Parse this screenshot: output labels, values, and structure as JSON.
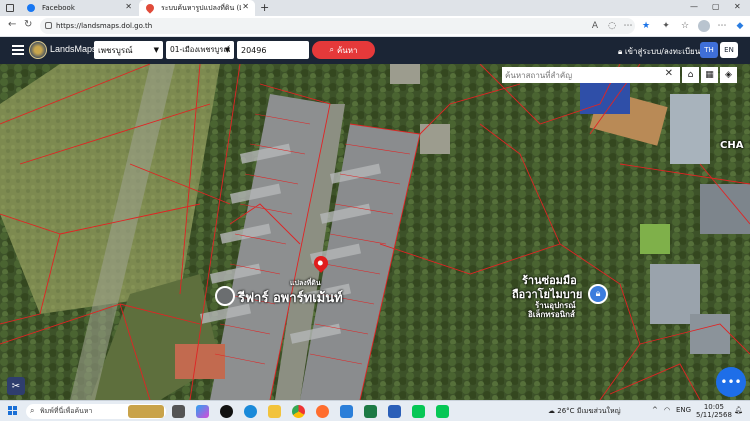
{
  "browser": {
    "tabs": [
      {
        "title": "Facebook",
        "active": false
      },
      {
        "title": "ระบบค้นหารูปแปลงที่ดิน (LandsMaps)",
        "active": true
      }
    ],
    "url": "https://landsmaps.dol.go.th"
  },
  "app": {
    "brand": "LandsMaps",
    "province": "เพชรบูรณ์",
    "district": "01-เมืองเพชรบูรณ์",
    "parcel_no": "20496",
    "search_label": "ค้นหา",
    "login_label": "เข้าสู่ระบบ/ลงทะเบียน",
    "lang_th": "TH",
    "lang_en": "EN"
  },
  "map": {
    "place_search_placeholder": "ค้นหาสถานที่สำคัญ",
    "labels": {
      "pin_caption": "แปลงที่ดิน",
      "apartment": "รีฟาร์ อพาร์ทเม้นท์",
      "shop_line1": "ร้านซ่อมมือ",
      "shop_line2": "ถือวาโยไมบาย",
      "shop_line3": "ร้านอุปกรณ์",
      "shop_line4": "อิเล็กทรอนิกส์",
      "edge_text": "CHA"
    },
    "colors": {
      "parcel_line": "#e02424",
      "pin": "#e01d1d",
      "fab": "#1e6ee8"
    }
  },
  "taskbar": {
    "search_placeholder": "พิมพ์ที่นี่เพื่อค้นหา",
    "weather": "26°C มีเมฆส่วนใหญ่",
    "lang": "ENG",
    "time": "10:05",
    "date": "5/11/2568"
  }
}
